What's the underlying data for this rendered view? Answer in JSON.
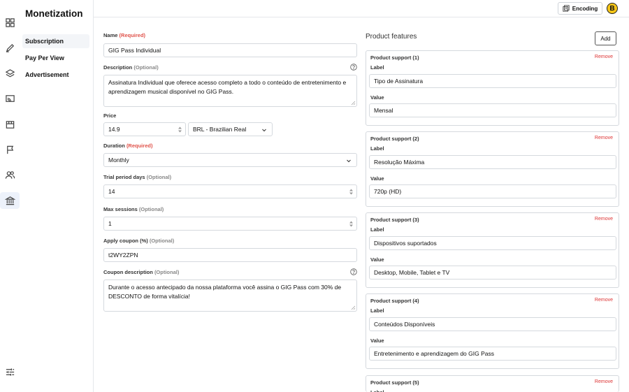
{
  "app": {
    "section_title": "Monetization",
    "brand_letter": "B"
  },
  "rail": {
    "icons": [
      "dashboard-icon",
      "edit-icon",
      "layers-icon",
      "cast-icon",
      "storefront-icon",
      "flag-icon",
      "users-icon",
      "bank-icon",
      "settings-sliders-icon"
    ],
    "active": "bank-icon"
  },
  "subnav": {
    "items": [
      {
        "label": "Subscription",
        "active": true
      },
      {
        "label": "Pay Per View",
        "active": false
      },
      {
        "label": "Advertisement",
        "active": false
      }
    ]
  },
  "topbar": {
    "encoding_label": "Encoding"
  },
  "form": {
    "name": {
      "label": "Name",
      "tag": "(Required)",
      "value": "GIG Pass Individual"
    },
    "description": {
      "label": "Description",
      "tag": "(Optional)",
      "value": "Assinatura Individual que oferece acesso completo a todo o conteúdo de entretenimento e aprendizagem musical disponível no GIG Pass."
    },
    "price": {
      "label": "Price",
      "value": "14.9",
      "currency": "BRL - Brazilian Real"
    },
    "duration": {
      "label": "Duration",
      "tag": "(Required)",
      "value": "Monthly"
    },
    "trial": {
      "label": "Trial period days",
      "tag": "(Optional)",
      "value": "14"
    },
    "max_sessions": {
      "label": "Max sessions",
      "tag": "(Optional)",
      "value": "1"
    },
    "coupon": {
      "label": "Apply coupon (%)",
      "tag": "(Optional)",
      "value": "t2WY2ZPN"
    },
    "coupon_description": {
      "label": "Coupon description",
      "tag": "(Optional)",
      "value": "Durante o acesso antecipado da nossa plataforma você assina o GIG Pass com 30% de DESCONTO de forma vitalícia!"
    }
  },
  "features": {
    "title": "Product features",
    "add_label": "Add",
    "remove_label": "Remove",
    "label_caption": "Label",
    "value_caption": "Value",
    "items": [
      {
        "title": "Product support (1)",
        "label": "Tipo de Assinatura",
        "value": "Mensal"
      },
      {
        "title": "Product support (2)",
        "label": "Resolução Máxima",
        "value": "720p (HD)"
      },
      {
        "title": "Product support (3)",
        "label": "Dispositivos suportados",
        "value": "Desktop, Mobile, Tablet e TV"
      },
      {
        "title": "Product support (4)",
        "label": "Conteúdos Disponíveis",
        "value": "Entretenimento e aprendizagem do GIG Pass"
      },
      {
        "title": "Product support (5)",
        "label": "",
        "value": ""
      }
    ]
  },
  "colors": {
    "required": "#e0524a",
    "remove": "#dd3333",
    "active_bg": "#edf2fb",
    "brand": "#f5c518"
  }
}
